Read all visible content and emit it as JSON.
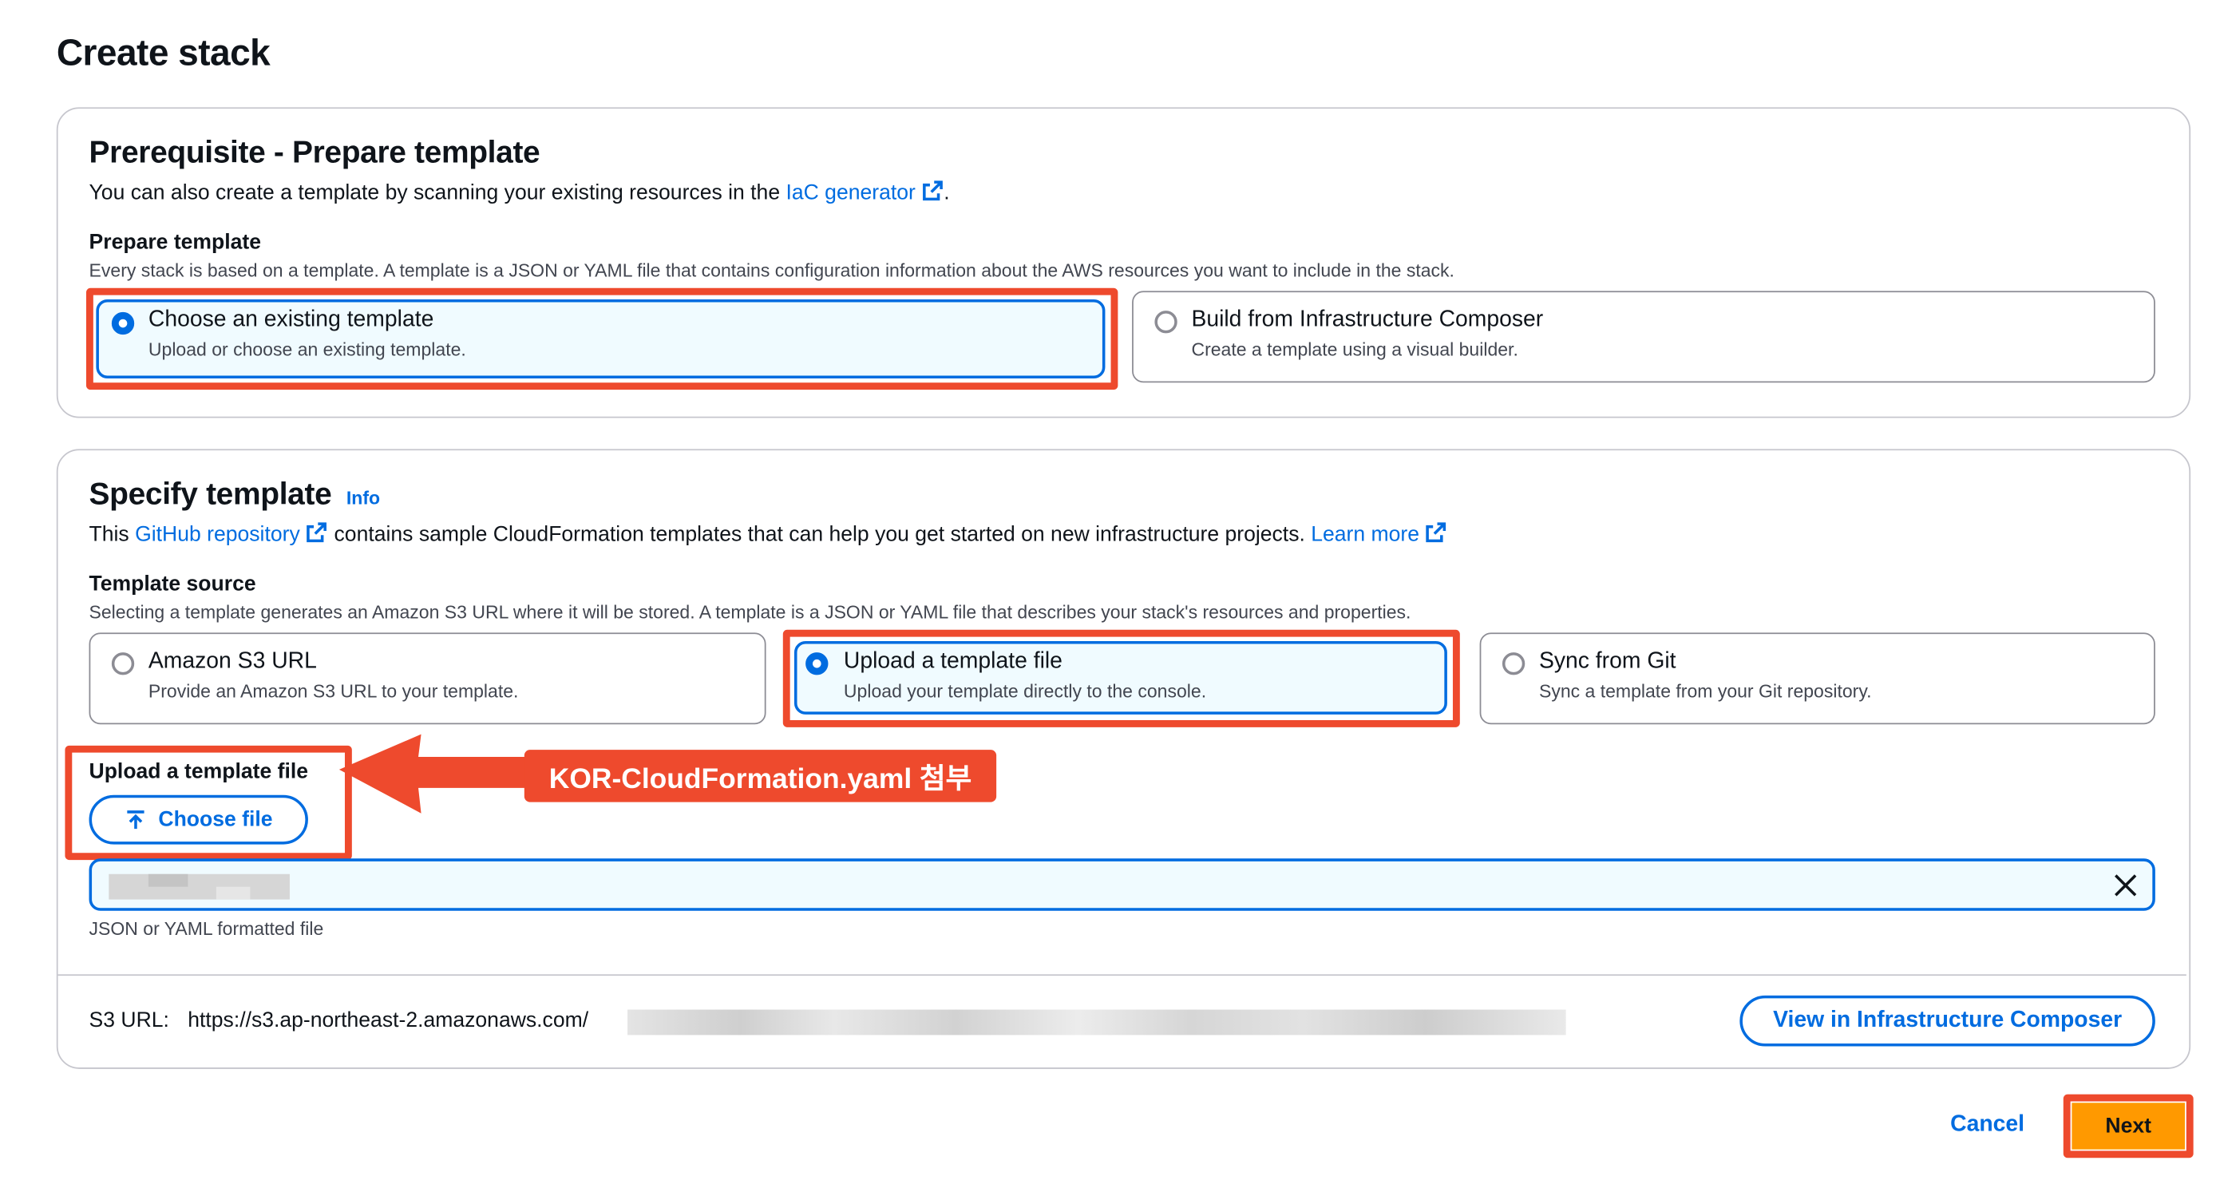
{
  "page": {
    "title": "Create stack"
  },
  "prereq": {
    "heading": "Prerequisite - Prepare template",
    "desc_before": "You can also create a template by scanning your existing resources in the",
    "desc_link": "IaC generator",
    "desc_after": ".",
    "field_label": "Prepare template",
    "field_desc": "Every stack is based on a template. A template is a JSON or YAML file that contains configuration information about the AWS resources you want to include in the stack.",
    "options": [
      {
        "title": "Choose an existing template",
        "sub": "Upload or choose an existing template.",
        "selected": true
      },
      {
        "title": "Build from Infrastructure Composer",
        "sub": "Create a template using a visual builder.",
        "selected": false
      }
    ]
  },
  "specify": {
    "heading": "Specify template",
    "info": "Info",
    "desc_before": "This",
    "desc_link1": "GitHub repository",
    "desc_middle": "contains sample CloudFormation templates that can help you get started on new infrastructure projects.",
    "desc_link2": "Learn more",
    "source_label": "Template source",
    "source_desc": "Selecting a template generates an Amazon S3 URL where it will be stored. A template is a JSON or YAML file that describes your stack's resources and properties.",
    "options": [
      {
        "title": "Amazon S3 URL",
        "sub": "Provide an Amazon S3 URL to your template.",
        "selected": false
      },
      {
        "title": "Upload a template file",
        "sub": "Upload your template directly to the console.",
        "selected": true
      },
      {
        "title": "Sync from Git",
        "sub": "Sync a template from your Git repository.",
        "selected": false
      }
    ],
    "upload_label": "Upload a template file",
    "choose_file": "Choose file",
    "file_hint": "JSON or YAML formatted file",
    "s3_label": "S3 URL:",
    "s3_value": "https://s3.ap-northeast-2.amazonaws.com/",
    "view_composer": "View in Infrastructure Composer"
  },
  "annotation": {
    "callout": "KOR-CloudFormation.yaml 첨부"
  },
  "footer": {
    "cancel": "Cancel",
    "next": "Next"
  },
  "colors": {
    "accent": "#006ce0",
    "highlight": "#ee4a2d",
    "primary_button": "#ff9900"
  }
}
